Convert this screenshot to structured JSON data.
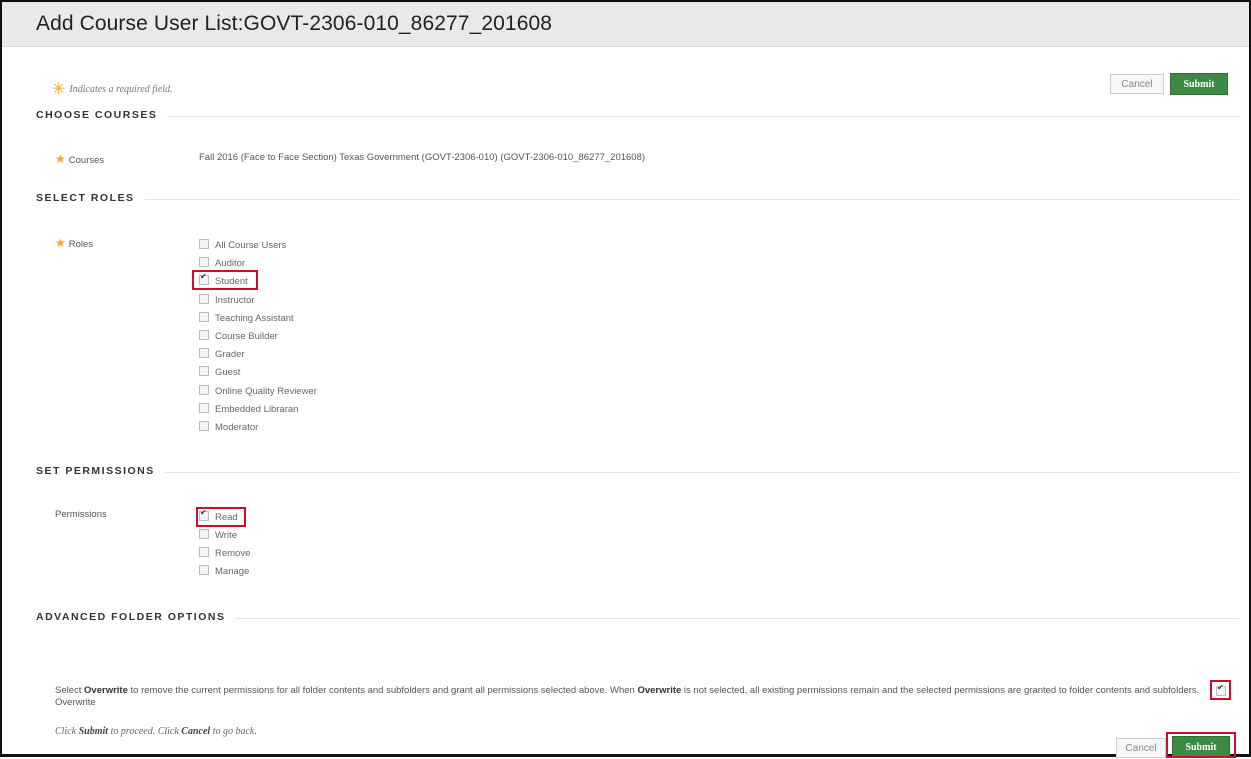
{
  "title": "Add Course User List:GOVT-2306-010_86277_201608",
  "required_note": "Indicates a required field.",
  "buttons": {
    "cancel": "Cancel",
    "submit": "Submit"
  },
  "sections": {
    "choose_courses": "CHOOSE COURSES",
    "select_roles": "SELECT ROLES",
    "set_permissions": "SET PERMISSIONS",
    "advanced": "ADVANCED FOLDER OPTIONS"
  },
  "courses": {
    "label": "Courses",
    "value": "Fall 2016 (Face to Face Section) Texas Government (GOVT-2306-010) (GOVT-2306-010_86277_201608)"
  },
  "roles": {
    "label": "Roles",
    "items": [
      {
        "label": "All Course Users",
        "checked": false
      },
      {
        "label": "Auditor",
        "checked": false
      },
      {
        "label": "Student",
        "checked": true
      },
      {
        "label": "Instructor",
        "checked": false
      },
      {
        "label": "Teaching Assistant",
        "checked": false
      },
      {
        "label": "Course Builder",
        "checked": false
      },
      {
        "label": "Grader",
        "checked": false
      },
      {
        "label": "Guest",
        "checked": false
      },
      {
        "label": "Online Quality Reviewer",
        "checked": false
      },
      {
        "label": "Embedded Libraran",
        "checked": false
      },
      {
        "label": "Moderator",
        "checked": false
      }
    ]
  },
  "permissions": {
    "label": "Permissions",
    "items": [
      {
        "label": "Read",
        "checked": true
      },
      {
        "label": "Write",
        "checked": false
      },
      {
        "label": "Remove",
        "checked": false
      },
      {
        "label": "Manage",
        "checked": false
      }
    ]
  },
  "advanced": {
    "text_1": "Select ",
    "bold_1": "Overwrite",
    "text_2": " to remove the current permissions for all folder contents and subfolders and grant all permissions selected above. When ",
    "bold_2": "Overwrite",
    "text_3": " is not selected, all existing permissions remain and the selected permissions are granted to folder contents and subfolders.",
    "overwrite_label": "Overwrite",
    "overwrite_checked": true
  },
  "footer": {
    "t1": "Click ",
    "b1": "Submit",
    "t2": " to proceed. Click ",
    "b2": "Cancel",
    "t3": " to go back."
  }
}
